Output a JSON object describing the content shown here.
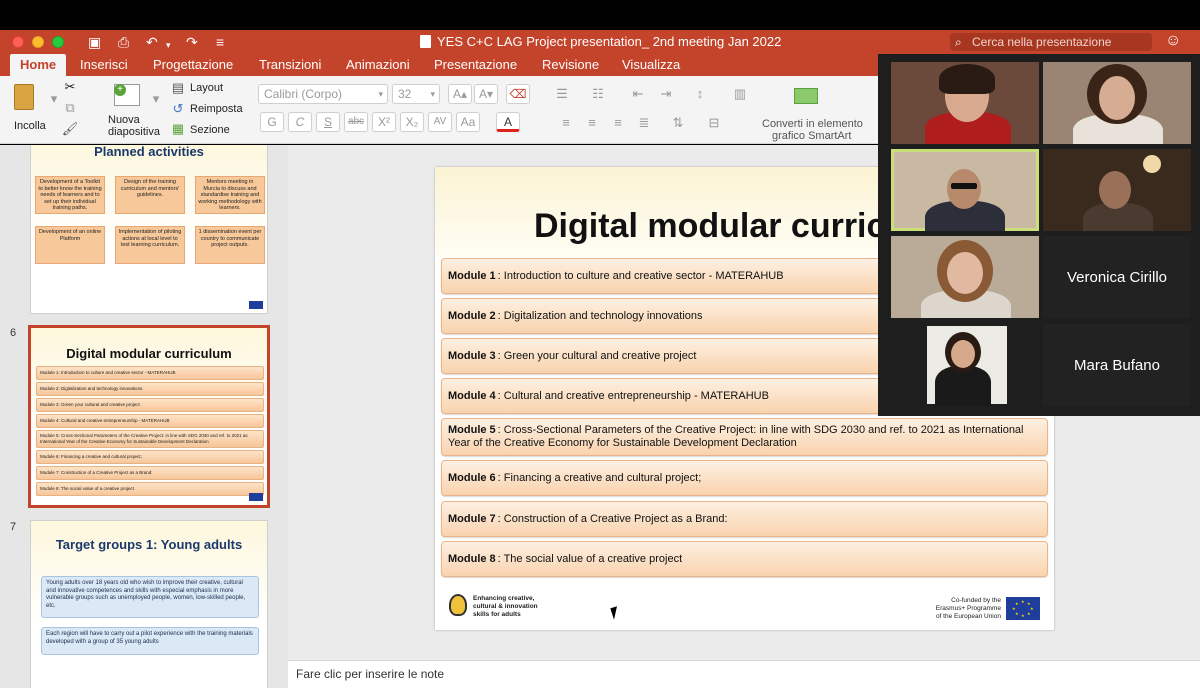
{
  "window": {
    "title": "YES C+C LAG Project presentation_ 2nd meeting Jan 2022",
    "search_placeholder": "Cerca nella presentazione"
  },
  "ribbon_tabs": [
    {
      "label": "Home",
      "active": true
    },
    {
      "label": "Inserisci"
    },
    {
      "label": "Progettazione"
    },
    {
      "label": "Transizioni"
    },
    {
      "label": "Animazioni"
    },
    {
      "label": "Presentazione"
    },
    {
      "label": "Revisione"
    },
    {
      "label": "Visualizza"
    }
  ],
  "ribbon": {
    "paste_label": "Incolla",
    "new_slide_label_1": "Nuova",
    "new_slide_label_2": "diapositiva",
    "layout_label": "Layout",
    "reset_label": "Reimposta",
    "section_label": "Sezione",
    "font_name": "Calibri (Corpo)",
    "font_size": "32",
    "smartart_label_1": "Converti in elemento",
    "smartart_label_2": "grafico SmartArt",
    "format_buttons": [
      "G",
      "C",
      "S",
      "abc",
      "X²",
      "X₂",
      "AV",
      "Aa",
      "A"
    ]
  },
  "thumbnails": {
    "slide5": {
      "title": "Planned activities",
      "boxes": [
        "Development of a Toolkit to better know the training needs of learners and to set up their individual training paths.",
        "Design of the training curriculum and mentors' guidelines.",
        "Mentors meeting in Murcia to discuss and standardise training and working methodology with learners.",
        "Development of an online Platform",
        "Implementation of piloting actions at local level to test learning curriculum.",
        "1 dissemination event per country to communicate project outputs."
      ]
    },
    "slide6": {
      "number": "6",
      "title": "Digital modular curriculum",
      "rows": [
        "Module 1: Introduction to culture and creative sector - MATERAHUB",
        "Module 2: Digitalization and technology innovations",
        "Module 3: Green your cultural and creative project",
        "Module 4: Cultural and creative entrepreneurship - MATERAHUB",
        "Module 5: Cross-Sectional Parameters of the Creative Project: in line with SDG 2030 and ref. to 2021 as International Year of the Creative Economy for Sustainable Development Declaration",
        "Module 6: Financing a creative and cultural project;",
        "Module 7: Construction of a Creative Project as a Brand:",
        "Module 8: The social value of a creative project"
      ]
    },
    "slide7": {
      "number": "7",
      "title": "Target groups 1: Young adults",
      "para1": "Young adults over 18 years old who wish to improve their creative, cultural and innovative competences and skills with especial emphasis in more vulnerable groups such as unemployed people, women, low-skilled people, etc.",
      "para2": "Each region will have to carry out a pilot experience with the training materials developed with a group of 35 young adults"
    }
  },
  "slide": {
    "title": "Digital modular curriculum",
    "modules": [
      {
        "label": "Module 1",
        "text": ": Introduction to culture and creative sector - MATERAHUB"
      },
      {
        "label": "Module 2",
        "text": ": Digitalization and technology innovations"
      },
      {
        "label": "Module 3",
        "text": ": Green your cultural and creative project"
      },
      {
        "label": "Module 4",
        "text": ": Cultural and creative entrepreneurship - MATERAHUB"
      },
      {
        "label": "Module 5",
        "text": ": Cross-Sectional Parameters of the Creative Project: in line with SDG 2030 and ref. to 2021 as International Year of the Creative Economy for Sustainable Development Declaration"
      },
      {
        "label": "Module 6",
        "text": ": Financing a creative and cultural project;"
      },
      {
        "label": "Module 7",
        "text": ": Construction of a Creative Project as a Brand:"
      },
      {
        "label": "Module 8",
        "text": ": The social value of a creative project"
      }
    ],
    "footer_logo_text": "Enhancing creative,\ncultural & innovation\nskills for adults",
    "footer_eu_text": "Co-funded by the Erasmus+ Programme of the European Union"
  },
  "notes_placeholder": "Fare clic per inserire le note",
  "video_call": {
    "participants": [
      {
        "name": "",
        "has_video": true
      },
      {
        "name": "",
        "has_video": true
      },
      {
        "name": "",
        "has_video": true,
        "active_speaker": true
      },
      {
        "name": "",
        "has_video": true
      },
      {
        "name": "",
        "has_video": true
      },
      {
        "name": "Veronica Cirillo",
        "has_video": false
      },
      {
        "name": "",
        "has_video": true
      },
      {
        "name": "Mara Bufano",
        "has_video": false
      }
    ]
  },
  "colors": {
    "accent": "#c4432b",
    "module_fill": "#f9d3ae",
    "active_speaker": "#c9e07a"
  }
}
